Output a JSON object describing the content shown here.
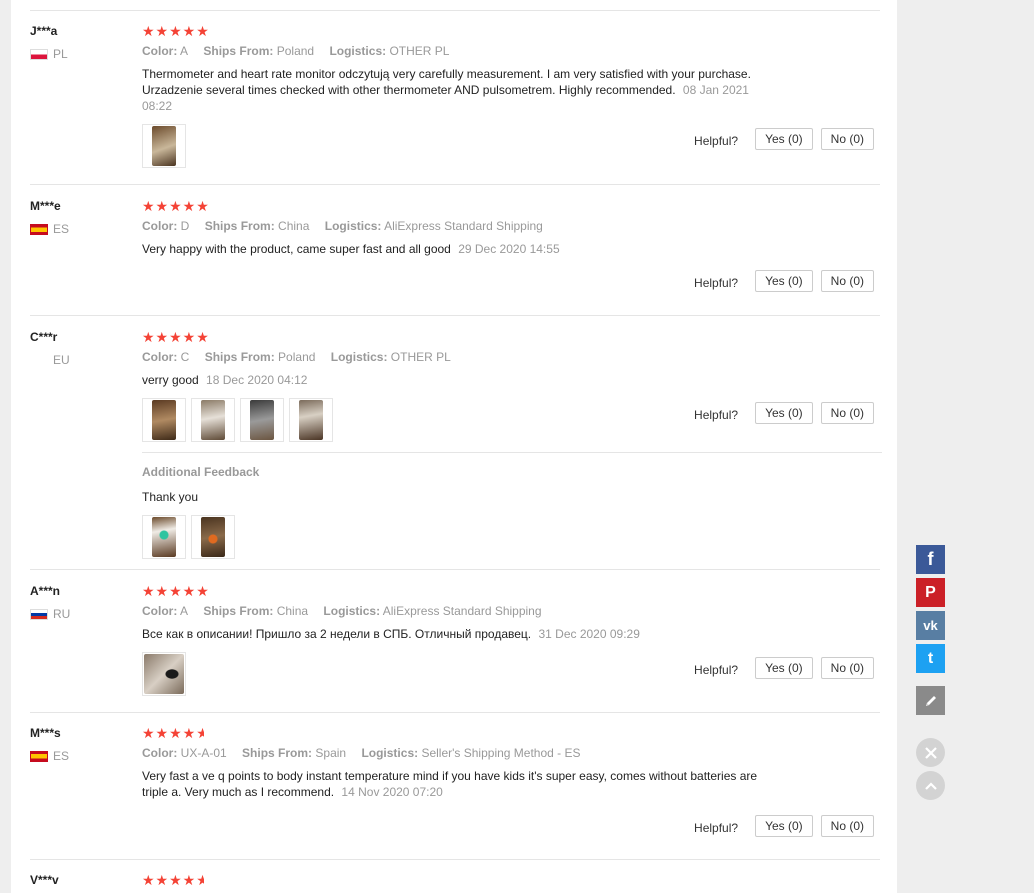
{
  "helpful_label": "Helpful?",
  "additional_label": "Additional Feedback",
  "color_label": "Color:",
  "ships_label": "Ships From:",
  "logistics_label": "Logistics:",
  "reviews": [
    {
      "user": "J***a",
      "country": "PL",
      "rating": 5,
      "color": "A",
      "ships_from": "Poland",
      "logistics": "OTHER PL",
      "text": "Thermometer and heart rate monitor odczytują very carefully measurement. I am very satisfied with your purchase. Urzadzenie several times checked with other thermometer AND pulsometrem. Highly recommended.",
      "date": "08 Jan 2021 08:22",
      "yes": "Yes (0)",
      "no": "No (0)"
    },
    {
      "user": "M***e",
      "country": "ES",
      "rating": 5,
      "color": "D",
      "ships_from": "China",
      "logistics": "AliExpress Standard Shipping",
      "text": "Very happy with the product, came super fast and all good",
      "date": "29 Dec 2020 14:55",
      "yes": "Yes (0)",
      "no": "No (0)"
    },
    {
      "user": "C***r",
      "country": "EU",
      "rating": 5,
      "color": "C",
      "ships_from": "Poland",
      "logistics": "OTHER PL",
      "text": "verry good",
      "date": "18 Dec 2020 04:12",
      "yes": "Yes (0)",
      "no": "No (0)",
      "additional_text": "Thank you"
    },
    {
      "user": "A***n",
      "country": "RU",
      "rating": 5,
      "color": "A",
      "ships_from": "China",
      "logistics": "AliExpress Standard Shipping",
      "text": "Все как в описании! Пришло за 2 недели в СПБ. Отличный продавец.",
      "date": "31 Dec 2020 09:29",
      "yes": "Yes (0)",
      "no": "No (0)"
    },
    {
      "user": "M***s",
      "country": "ES",
      "rating": 4.5,
      "color": "UX-A-01",
      "ships_from": "Spain",
      "logistics": "Seller's Shipping Method - ES",
      "text": "Very fast a ve q points to body instant temperature mind if you have kids it's super easy, comes without batteries are triple a. Very much as I recommend.",
      "date": "14 Nov 2020 07:20",
      "yes": "Yes (0)",
      "no": "No (0)"
    },
    {
      "user": "V***v",
      "rating": 4.5
    }
  ],
  "sidebar": {
    "facebook_glyph": "f",
    "pinterest_glyph": "P",
    "vk_glyph": "vk",
    "twitter_glyph": "t",
    "colors": {
      "facebook": "#3b5998",
      "pinterest": "#cb2027",
      "vk": "#587ea3",
      "twitter": "#1da1f2",
      "write": "#8a8a8a"
    }
  },
  "colors": {
    "star": "#f44336",
    "muted": "#999999"
  }
}
